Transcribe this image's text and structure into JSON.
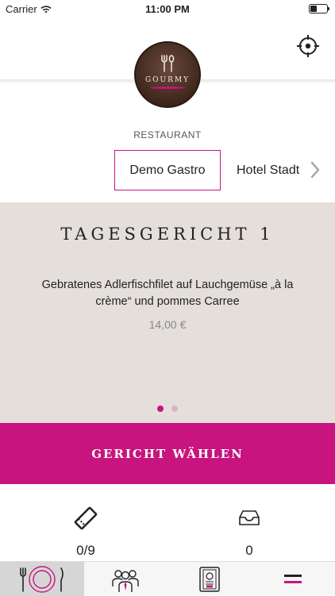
{
  "status_bar": {
    "carrier": "Carrier",
    "time": "11:00 PM",
    "wifi_icon": "wifi-icon",
    "battery_icon": "battery-icon"
  },
  "header": {
    "logo_text": "GOURMY",
    "logo_icon": "fork-spoon-icon",
    "locate_icon": "locate-crosshair-icon"
  },
  "restaurant": {
    "label": "RESTAURANT",
    "options": [
      "Demo Gastro",
      "Hotel Stadt"
    ],
    "selected_index": 0,
    "next_icon": "chevron-right-icon"
  },
  "dish": {
    "title": "TAGESGERICHT 1",
    "description": "Gebratenes Adlerfischfilet auf Lauchgemüse „à la crème“ und pommes Carree",
    "price": "14,00 €",
    "pages": 2,
    "current_page": 0
  },
  "choose_button": {
    "label": "GERICHT WÄHLEN"
  },
  "counters": {
    "vouchers_icon": "ticket-icon",
    "vouchers_value": "0/9",
    "inbox_icon": "inbox-icon",
    "inbox_value": "0"
  },
  "tabbar": {
    "tabs": [
      {
        "icon": "plate-cutlery-icon",
        "active": true
      },
      {
        "icon": "users-icon",
        "active": false
      },
      {
        "icon": "menu-card-icon",
        "active": false
      },
      {
        "icon": "hamburger-menu-icon",
        "active": false
      }
    ]
  },
  "colors": {
    "accent": "#c8147e",
    "card_background": "#e4dfdb",
    "dot_inactive": "#d7b5c7",
    "price_text": "#888888"
  }
}
